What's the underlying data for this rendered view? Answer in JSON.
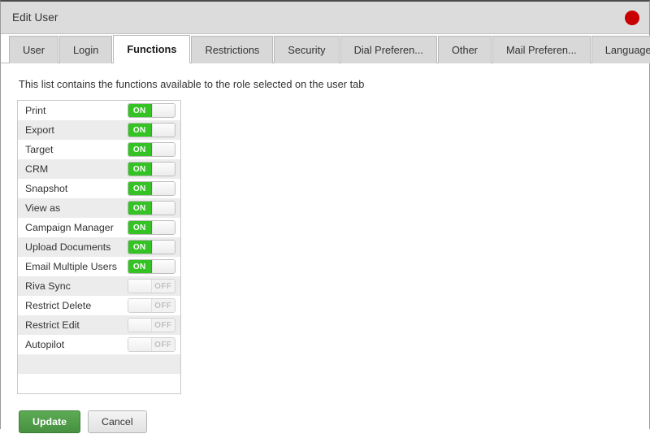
{
  "window": {
    "title": "Edit User",
    "close_icon": "close-circle-icon"
  },
  "tabs": [
    {
      "label": "User",
      "active": false
    },
    {
      "label": "Login",
      "active": false
    },
    {
      "label": "Functions",
      "active": true
    },
    {
      "label": "Restrictions",
      "active": false
    },
    {
      "label": "Security",
      "active": false
    },
    {
      "label": "Dial Preferen...",
      "active": false
    },
    {
      "label": "Other",
      "active": false
    },
    {
      "label": "Mail Preferen...",
      "active": false
    },
    {
      "label": "Language Pre...",
      "active": false
    }
  ],
  "content": {
    "description": "This list contains the functions available to the role selected on the user tab",
    "toggle_on_label": "ON",
    "toggle_off_label": "OFF",
    "functions": [
      {
        "label": "Print",
        "state": "on"
      },
      {
        "label": "Export",
        "state": "on"
      },
      {
        "label": "Target",
        "state": "on"
      },
      {
        "label": "CRM",
        "state": "on"
      },
      {
        "label": "Snapshot",
        "state": "on"
      },
      {
        "label": "View as",
        "state": "on"
      },
      {
        "label": "Campaign Manager",
        "state": "on"
      },
      {
        "label": "Upload Documents",
        "state": "on"
      },
      {
        "label": "Email Multiple Users",
        "state": "on"
      },
      {
        "label": "Riva Sync",
        "state": "off"
      },
      {
        "label": "Restrict Delete",
        "state": "off"
      },
      {
        "label": "Restrict Edit",
        "state": "off"
      },
      {
        "label": "Autopilot",
        "state": "off"
      },
      {
        "label": "",
        "state": "none"
      },
      {
        "label": "",
        "state": "none"
      }
    ]
  },
  "footer": {
    "update_label": "Update",
    "cancel_label": "Cancel"
  },
  "colors": {
    "toggle_on": "#34c224",
    "toggle_off_text": "#c2c2c2",
    "primary_button": "#4d9a46",
    "close_dot": "#c80000",
    "titlebar": "#dcdcdc",
    "tab_inactive": "#d8d8d8",
    "row_alt": "#ececec"
  }
}
